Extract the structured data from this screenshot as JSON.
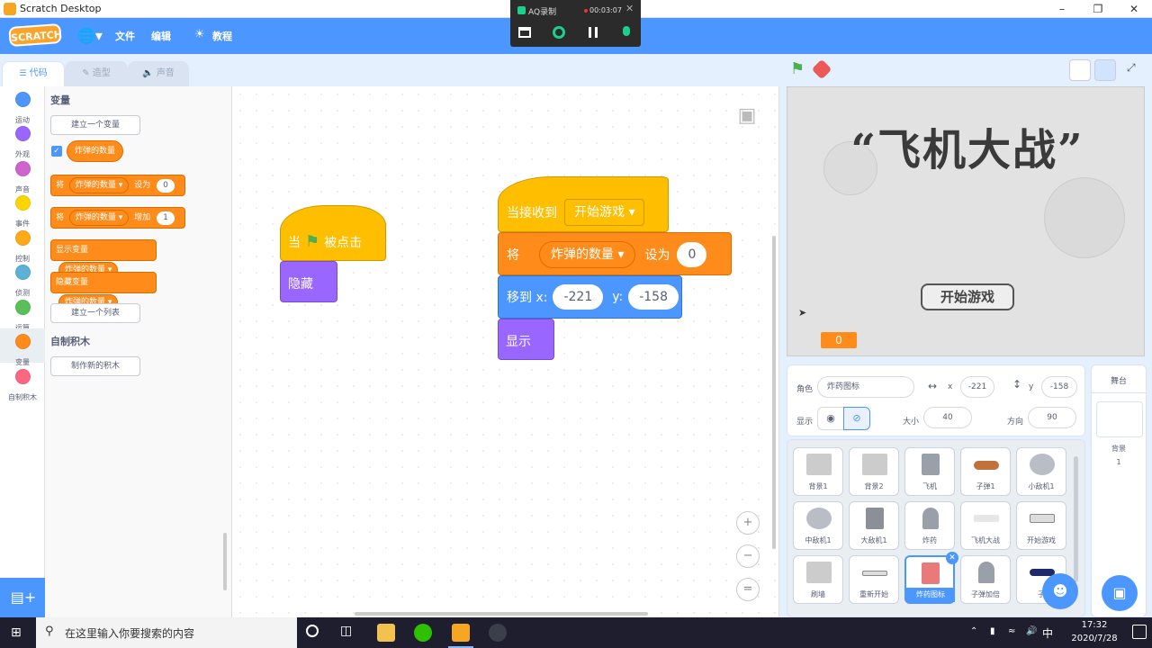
{
  "window": {
    "title": "Scratch Desktop"
  },
  "recorder": {
    "title": "AQ录制",
    "time": "00:03:07"
  },
  "menubar": {
    "logo": "SCRATCH",
    "file": "文件",
    "edit": "编辑",
    "tutorials": "教程",
    "globe_icon": "globe-icon"
  },
  "tabs": {
    "code": "代码",
    "costumes": "造型",
    "sounds": "声音"
  },
  "categories": [
    {
      "label": "运动",
      "color": "#4c97ff"
    },
    {
      "label": "外观",
      "color": "#9966ff"
    },
    {
      "label": "声音",
      "color": "#cf63cf"
    },
    {
      "label": "事件",
      "color": "#ffd500"
    },
    {
      "label": "控制",
      "color": "#ffab19"
    },
    {
      "label": "侦测",
      "color": "#5cb1d6"
    },
    {
      "label": "运算",
      "color": "#59c059"
    },
    {
      "label": "变量",
      "color": "#ff8c1a"
    },
    {
      "label": "自制积木",
      "color": "#ff6680"
    }
  ],
  "palette": {
    "variables_title": "变量",
    "make_variable": "建立一个变量",
    "variable_name": "炸弹的数量",
    "set_prefix": "将",
    "set_var": "炸弹的数量",
    "set_to": "设为",
    "set_value": "0",
    "change_prefix": "将",
    "change_var": "炸弹的数量",
    "change_by": "增加",
    "change_value": "1",
    "show_var": "显示变量",
    "show_var_name": "炸弹的数量",
    "hide_var": "隐藏变量",
    "hide_var_name": "炸弹的数量",
    "make_list": "建立一个列表",
    "my_blocks_title": "自制积木",
    "make_block": "制作新的积木"
  },
  "script1": {
    "hat_prefix": "当",
    "hat_suffix": "被点击",
    "hide": "隐藏"
  },
  "script2": {
    "hat_prefix": "当接收到",
    "hat_message": "开始游戏",
    "set_prefix": "将",
    "set_var": "炸弹的数量",
    "set_to": "设为",
    "set_value": "0",
    "goto_label": "移到 x:",
    "goto_x": "-221",
    "goto_y_label": "y:",
    "goto_y": "-158",
    "show": "显示"
  },
  "stage": {
    "game_title": "“飞机大战”",
    "start_button": "开始游戏",
    "monitor_value": "0"
  },
  "sprite_info": {
    "sprite_label": "角色",
    "sprite_name": "炸药图标",
    "x_label": "x",
    "x_value": "-221",
    "y_label": "y",
    "y_value": "-158",
    "show_label": "显示",
    "size_label": "大小",
    "size_value": "40",
    "direction_label": "方向",
    "direction_value": "90"
  },
  "sprites": [
    {
      "name": "背景1",
      "color": "#cccccc"
    },
    {
      "name": "背景2",
      "color": "#cccccc"
    },
    {
      "name": "飞机",
      "color": "#9aa0aa"
    },
    {
      "name": "子弹1",
      "color": "#c0723a"
    },
    {
      "name": "小敌机1",
      "color": "#b9bec6"
    },
    {
      "name": "中敌机1",
      "color": "#b9bec6"
    },
    {
      "name": "大敌机1",
      "color": "#8a8f98"
    },
    {
      "name": "炸药",
      "color": "#9aa0aa"
    },
    {
      "name": "飞机大战",
      "color": "#e6e6e6"
    },
    {
      "name": "开始游戏",
      "color": "#dddddd"
    },
    {
      "name": "刷墙",
      "color": "#cccccc"
    },
    {
      "name": "重新开始",
      "color": "#dddddd"
    },
    {
      "name": "炸药图标",
      "color": "#e87a7a"
    },
    {
      "name": "子弹加倍",
      "color": "#9aa0aa"
    },
    {
      "name": "子",
      "color": "#1f2a6b"
    }
  ],
  "stage_pane": {
    "title": "舞台",
    "backdrops_label": "背景",
    "backdrops_count": "1"
  },
  "taskbar": {
    "search_placeholder": "在这里输入你要搜索的内容",
    "time": "17:32",
    "date": "2020/7/28",
    "ime": "中"
  }
}
